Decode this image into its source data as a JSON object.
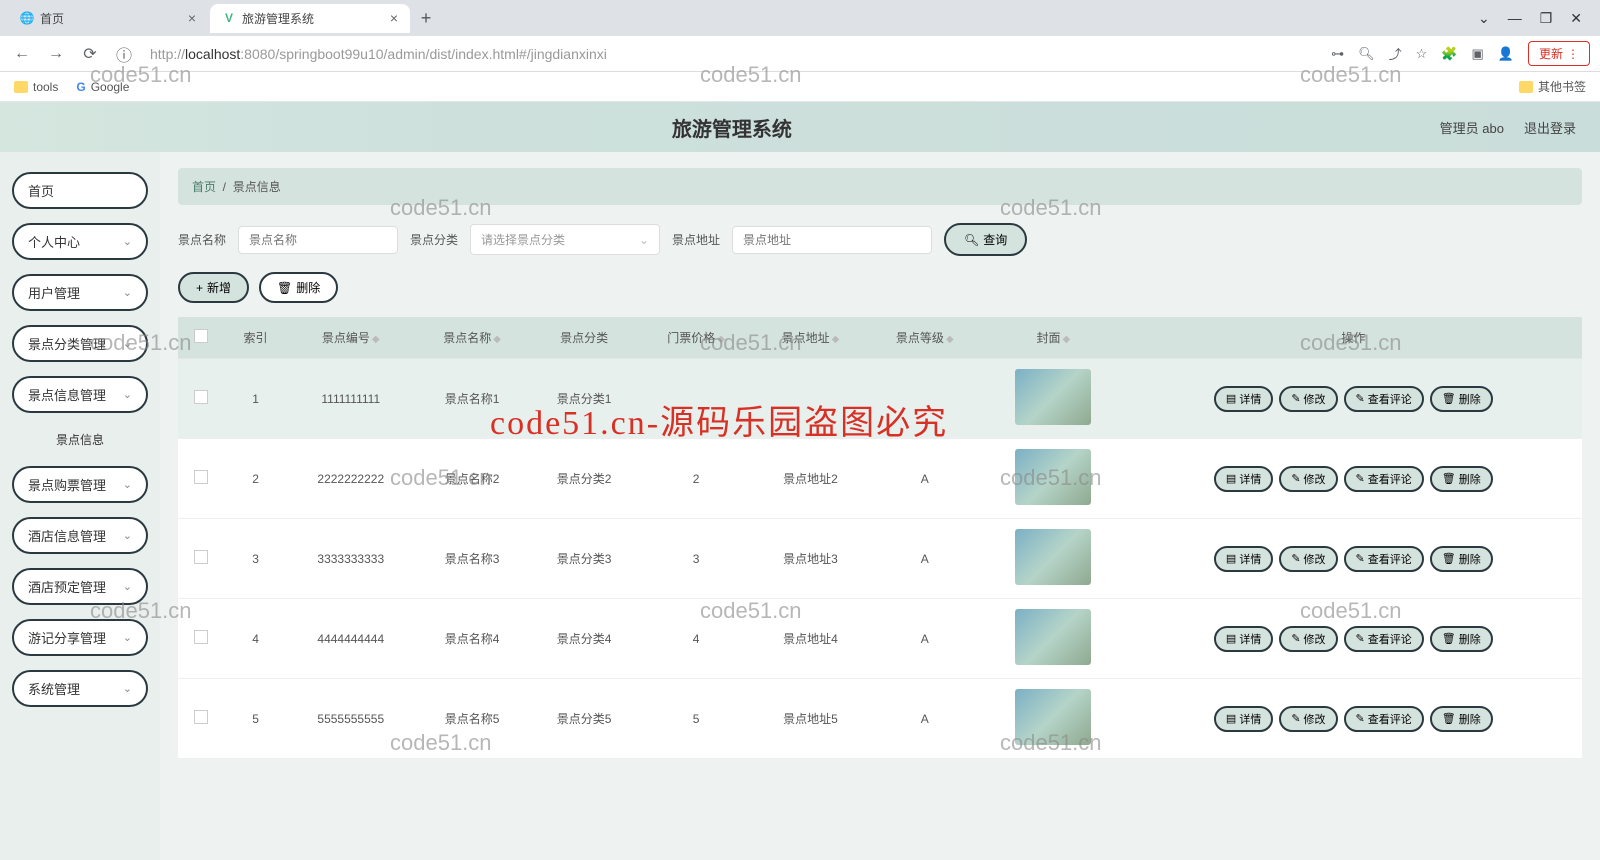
{
  "browser": {
    "tab1": "首页",
    "tab2": "旅游管理系统",
    "url_host": "localhost",
    "url_path": ":8080/springboot99u10/admin/dist/index.html#/jingdianxinxi",
    "url_prefix": "http://",
    "update": "更新",
    "bookmarks": {
      "tools": "tools",
      "google": "Google",
      "other": "其他书签"
    }
  },
  "header": {
    "title": "旅游管理系统",
    "user": "管理员 abo",
    "logout": "退出登录"
  },
  "sidebar": {
    "items": [
      "首页",
      "个人中心",
      "用户管理",
      "景点分类管理",
      "景点信息管理",
      "景点信息",
      "景点购票管理",
      "酒店信息管理",
      "酒店预定管理",
      "游记分享管理",
      "系统管理"
    ]
  },
  "breadcrumb": {
    "home": "首页",
    "current": "景点信息"
  },
  "search": {
    "name_label": "景点名称",
    "name_ph": "景点名称",
    "cat_label": "景点分类",
    "cat_ph": "请选择景点分类",
    "addr_label": "景点地址",
    "addr_ph": "景点地址",
    "query": "查询"
  },
  "actions": {
    "add": "新增",
    "del": "删除"
  },
  "table": {
    "headers": [
      "索引",
      "景点编号",
      "景点名称",
      "景点分类",
      "门票价格",
      "景点地址",
      "景点等级",
      "封面",
      "操作"
    ],
    "btns": {
      "detail": "详情",
      "edit": "修改",
      "comments": "查看评论",
      "del": "删除"
    },
    "rows": [
      {
        "idx": "1",
        "code": "1111111111",
        "name": "景点名称1",
        "cat": "景点分类1",
        "price": "",
        "addr": "",
        "grade": "",
        "active": true
      },
      {
        "idx": "2",
        "code": "2222222222",
        "name": "景点名称2",
        "cat": "景点分类2",
        "price": "2",
        "addr": "景点地址2",
        "grade": "A",
        "active": false
      },
      {
        "idx": "3",
        "code": "3333333333",
        "name": "景点名称3",
        "cat": "景点分类3",
        "price": "3",
        "addr": "景点地址3",
        "grade": "A",
        "active": false
      },
      {
        "idx": "4",
        "code": "4444444444",
        "name": "景点名称4",
        "cat": "景点分类4",
        "price": "4",
        "addr": "景点地址4",
        "grade": "A",
        "active": false
      },
      {
        "idx": "5",
        "code": "5555555555",
        "name": "景点名称5",
        "cat": "景点分类5",
        "price": "5",
        "addr": "景点地址5",
        "grade": "A",
        "active": false
      }
    ]
  },
  "watermarks": {
    "small": "code51.cn",
    "big": "code51.cn-源码乐园盗图必究"
  }
}
